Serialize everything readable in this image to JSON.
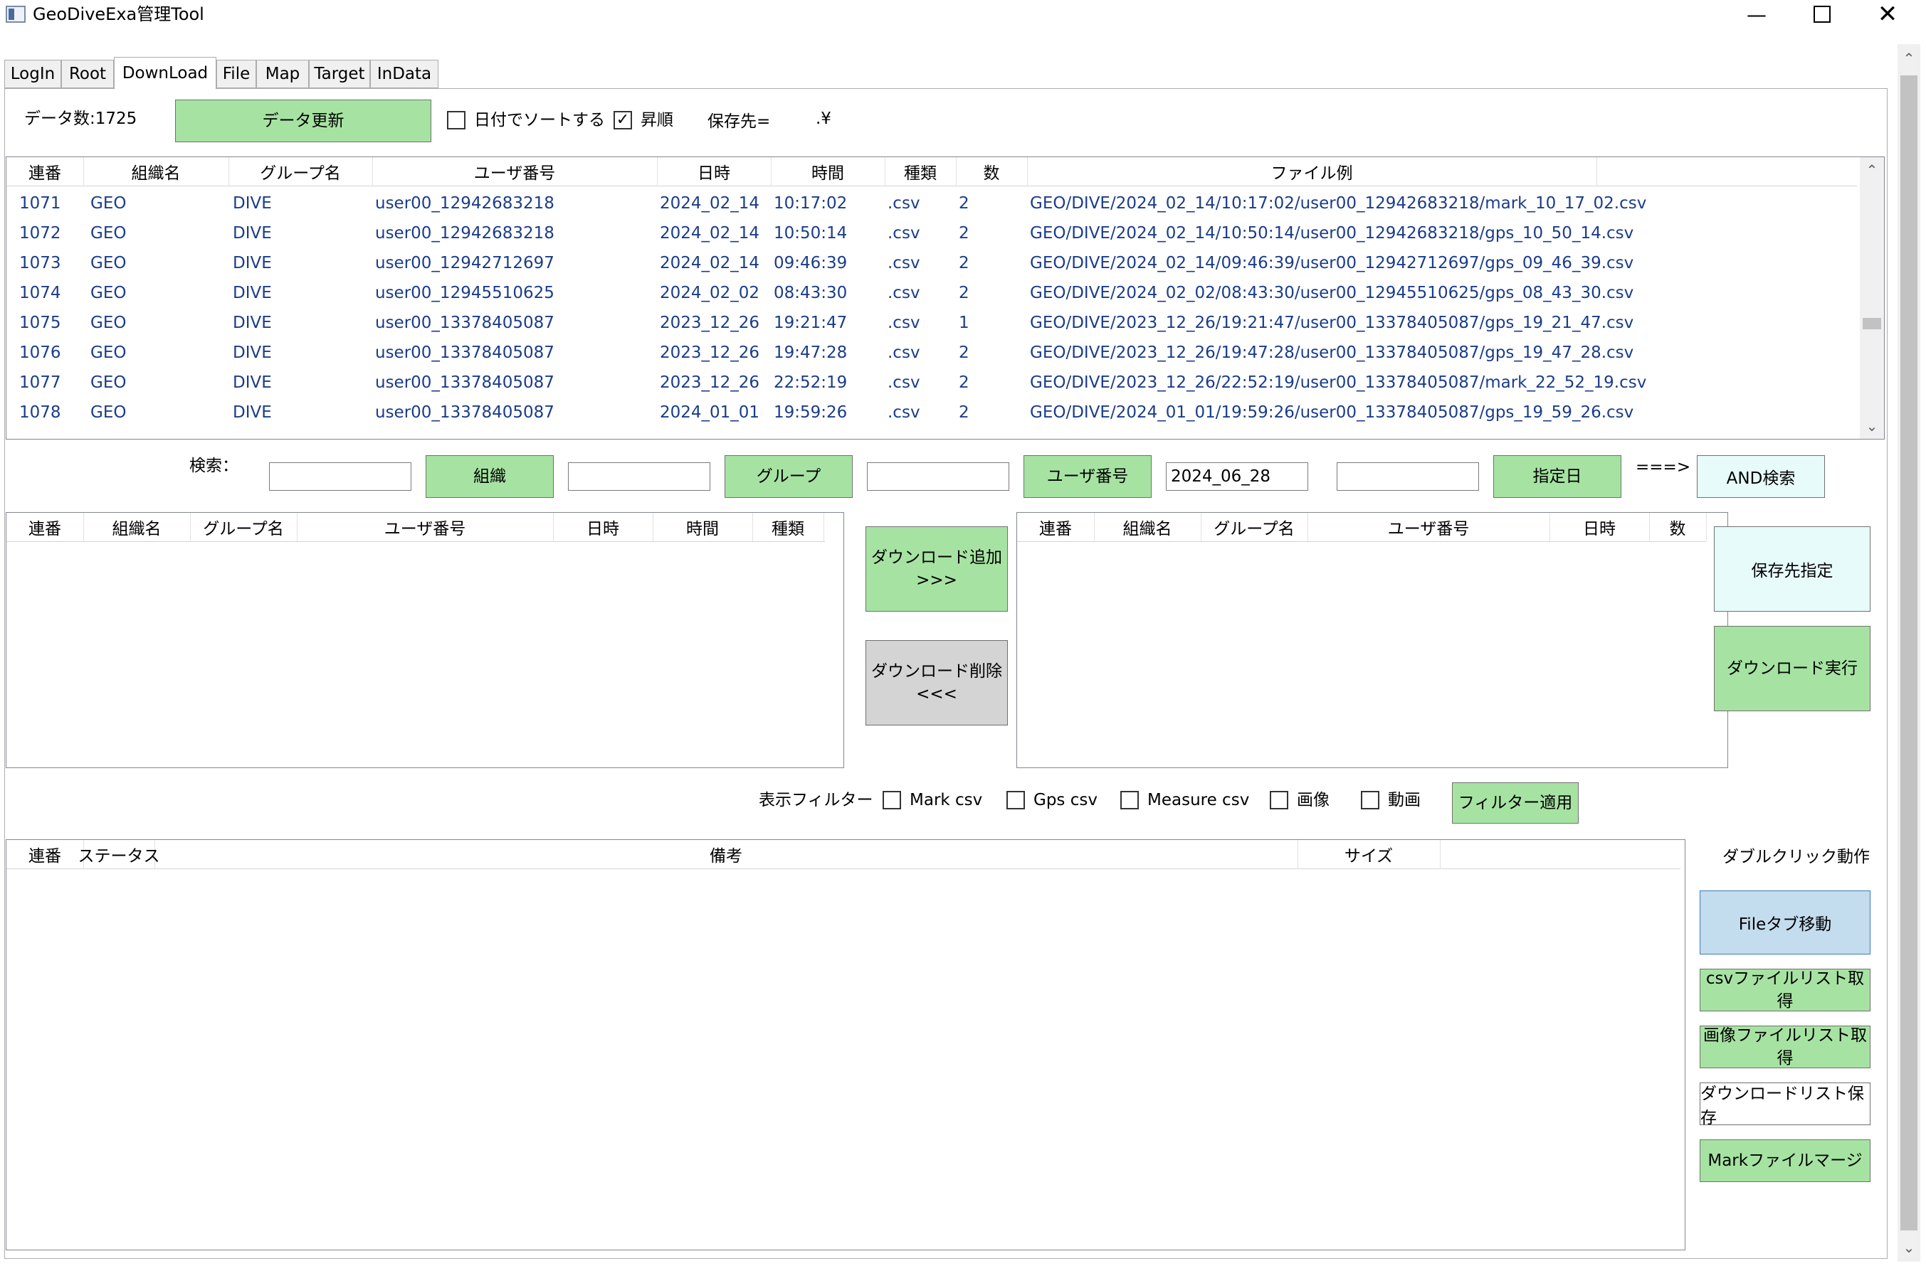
{
  "window": {
    "title": "GeoDiveExa管理Tool"
  },
  "tabs": [
    "LogIn",
    "Root",
    "DownLoad",
    "File",
    "Map",
    "Target",
    "InData"
  ],
  "top": {
    "data_count": "データ数:1725",
    "refresh_button": "データ更新",
    "sort_by_date_label": "日付でソートする",
    "ascending_label": "昇順",
    "save_dest_label": "保存先=",
    "save_dest_value": ".¥"
  },
  "main_table": {
    "columns": [
      "連番",
      "組織名",
      "グループ名",
      "ユーザ番号",
      "日時",
      "時間",
      "種類",
      "数",
      "ファイル例"
    ],
    "rows": [
      [
        "1071",
        "GEO",
        "DIVE",
        "user00_12942683218",
        "2024_02_14",
        "10:17:02",
        ".csv",
        "2",
        "GEO/DIVE/2024_02_14/10:17:02/user00_12942683218/mark_10_17_02.csv"
      ],
      [
        "1072",
        "GEO",
        "DIVE",
        "user00_12942683218",
        "2024_02_14",
        "10:50:14",
        ".csv",
        "2",
        "GEO/DIVE/2024_02_14/10:50:14/user00_12942683218/gps_10_50_14.csv"
      ],
      [
        "1073",
        "GEO",
        "DIVE",
        "user00_12942712697",
        "2024_02_14",
        "09:46:39",
        ".csv",
        "2",
        "GEO/DIVE/2024_02_14/09:46:39/user00_12942712697/gps_09_46_39.csv"
      ],
      [
        "1074",
        "GEO",
        "DIVE",
        "user00_12945510625",
        "2024_02_02",
        "08:43:30",
        ".csv",
        "2",
        "GEO/DIVE/2024_02_02/08:43:30/user00_12945510625/gps_08_43_30.csv"
      ],
      [
        "1075",
        "GEO",
        "DIVE",
        "user00_13378405087",
        "2023_12_26",
        "19:21:47",
        ".csv",
        "1",
        "GEO/DIVE/2023_12_26/19:21:47/user00_13378405087/gps_19_21_47.csv"
      ],
      [
        "1076",
        "GEO",
        "DIVE",
        "user00_13378405087",
        "2023_12_26",
        "19:47:28",
        ".csv",
        "2",
        "GEO/DIVE/2023_12_26/19:47:28/user00_13378405087/gps_19_47_28.csv"
      ],
      [
        "1077",
        "GEO",
        "DIVE",
        "user00_13378405087",
        "2023_12_26",
        "22:52:19",
        ".csv",
        "2",
        "GEO/DIVE/2023_12_26/22:52:19/user00_13378405087/mark_22_52_19.csv"
      ],
      [
        "1078",
        "GEO",
        "DIVE",
        "user00_13378405087",
        "2024_01_01",
        "19:59:26",
        ".csv",
        "2",
        "GEO/DIVE/2024_01_01/19:59:26/user00_13378405087/gps_19_59_26.csv"
      ]
    ]
  },
  "search": {
    "label": "検索：",
    "org_input": "",
    "org_button": "組織",
    "group_input": "",
    "group_button": "グループ",
    "user_input": "",
    "user_button": "ユーザ番号",
    "date_input": "2024_06_28",
    "extra_input": "",
    "date_button": "指定日",
    "arrow": "===>",
    "and_button": "AND検索"
  },
  "left_list": {
    "columns": [
      "連番",
      "組織名",
      "グループ名",
      "ユーザ番号",
      "日時",
      "時間",
      "種類"
    ]
  },
  "middle": {
    "add_line1": "ダウンロード追加",
    "add_line2": ">>>",
    "remove_line1": "ダウンロード削除",
    "remove_line2": "<<<"
  },
  "right_list": {
    "columns": [
      "連番",
      "組織名",
      "グループ名",
      "ユーザ番号",
      "日時",
      "数"
    ]
  },
  "right_buttons": {
    "save_dest": "保存先指定",
    "download_run": "ダウンロード実行"
  },
  "filter": {
    "label": "表示フィルター",
    "mark_csv": "Mark csv",
    "gps_csv": "Gps csv",
    "measure_csv": "Measure csv",
    "image": "画像",
    "video": "動画",
    "apply_button": "フィルター適用"
  },
  "status_table": {
    "columns": [
      "連番",
      "ステータス",
      "備考",
      "サイズ"
    ]
  },
  "dblclick": {
    "label": "ダブルクリック動作",
    "file_tab_move": "Fileタブ移動",
    "csv_list": "csvファイルリスト取得",
    "image_list": "画像ファイルリスト取得",
    "save_download_list": "ダウンロードリスト保存",
    "mark_merge": "Markファイルマージ"
  },
  "colors": {
    "green_button": "#a6e3a2",
    "row_text": "#1a3c8a",
    "blue_button": "#c3dcee"
  }
}
